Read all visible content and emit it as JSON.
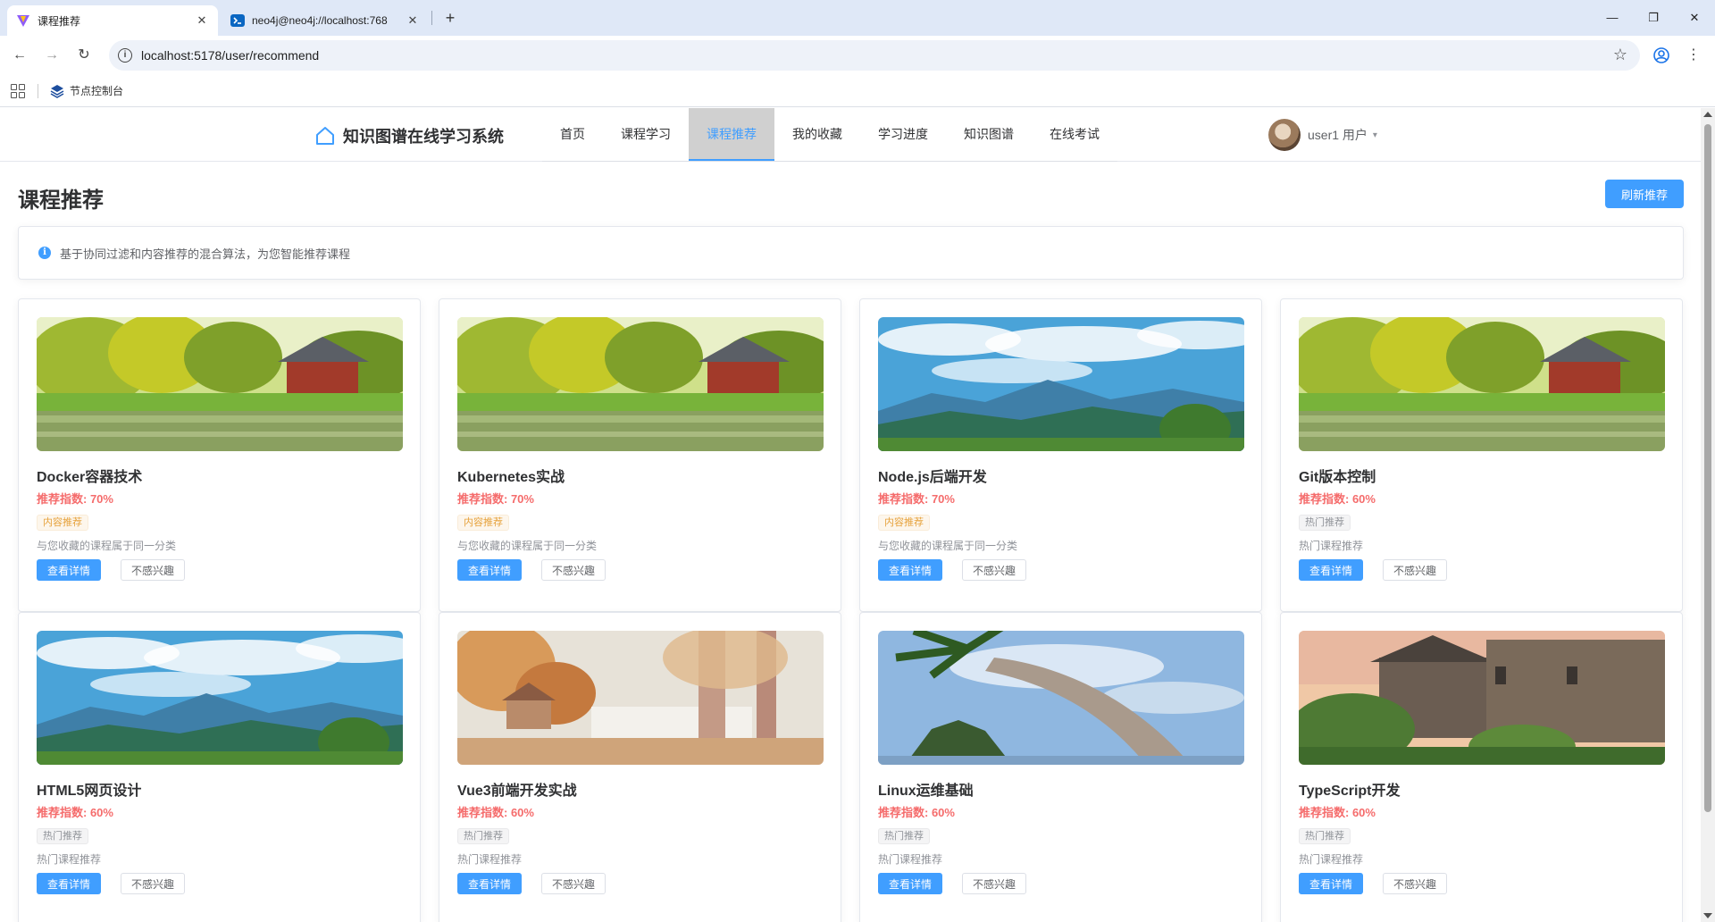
{
  "browser": {
    "tabs": [
      {
        "title": "课程推荐",
        "active": true
      },
      {
        "title": "neo4j@neo4j://localhost:768",
        "active": false
      }
    ],
    "url": "localhost:5178/user/recommend",
    "bookmarks": [
      {
        "label": "节点控制台"
      }
    ]
  },
  "header": {
    "logo_text": "知识图谱在线学习系统",
    "menu": [
      {
        "label": "首页",
        "active": false
      },
      {
        "label": "课程学习",
        "active": false
      },
      {
        "label": "课程推荐",
        "active": true
      },
      {
        "label": "我的收藏",
        "active": false
      },
      {
        "label": "学习进度",
        "active": false
      },
      {
        "label": "知识图谱",
        "active": false
      },
      {
        "label": "在线考试",
        "active": false
      }
    ],
    "user": {
      "name": "user1",
      "role": "用户"
    }
  },
  "page": {
    "title": "课程推荐",
    "refresh_label": "刷新推荐",
    "tip": "基于协同过滤和内容推荐的混合算法，为您智能推荐课程"
  },
  "courses": [
    {
      "title": "Docker容器技术",
      "score": "推荐指数: 70%",
      "tag": "内容推荐",
      "reason": "与您收藏的课程属于同一分类",
      "image": "pavilion",
      "detail_label": "查看详情",
      "dislike_label": "不感兴趣"
    },
    {
      "title": "Kubernetes实战",
      "score": "推荐指数: 70%",
      "tag": "内容推荐",
      "reason": "与您收藏的课程属于同一分类",
      "image": "pavilion",
      "detail_label": "查看详情",
      "dislike_label": "不感兴趣"
    },
    {
      "title": "Node.js后端开发",
      "score": "推荐指数: 70%",
      "tag": "内容推荐",
      "reason": "与您收藏的课程属于同一分类",
      "image": "mountains",
      "detail_label": "查看详情",
      "dislike_label": "不感兴趣"
    },
    {
      "title": "Git版本控制",
      "score": "推荐指数: 60%",
      "tag": "热门推荐",
      "reason": "热门课程推荐",
      "image": "pavilion",
      "detail_label": "查看详情",
      "dislike_label": "不感兴趣"
    },
    {
      "title": "HTML5网页设计",
      "score": "推荐指数: 60%",
      "tag": "热门推荐",
      "reason": "热门课程推荐",
      "image": "mountains",
      "detail_label": "查看详情",
      "dislike_label": "不感兴趣"
    },
    {
      "title": "Vue3前端开发实战",
      "score": "推荐指数: 60%",
      "tag": "热门推荐",
      "reason": "热门课程推荐",
      "image": "autumn",
      "detail_label": "查看详情",
      "dislike_label": "不感兴趣"
    },
    {
      "title": "Linux运维基础",
      "score": "推荐指数: 60%",
      "tag": "热门推荐",
      "reason": "热门课程推荐",
      "image": "palm",
      "detail_label": "查看详情",
      "dislike_label": "不感兴趣"
    },
    {
      "title": "TypeScript开发",
      "score": "推荐指数: 60%",
      "tag": "热门推荐",
      "reason": "热门课程推荐",
      "image": "castle",
      "detail_label": "查看详情",
      "dislike_label": "不感兴趣"
    }
  ],
  "colors": {
    "primary": "#409eff",
    "danger": "#f56c6c",
    "warning": "#e6a23c",
    "info": "#909399"
  }
}
